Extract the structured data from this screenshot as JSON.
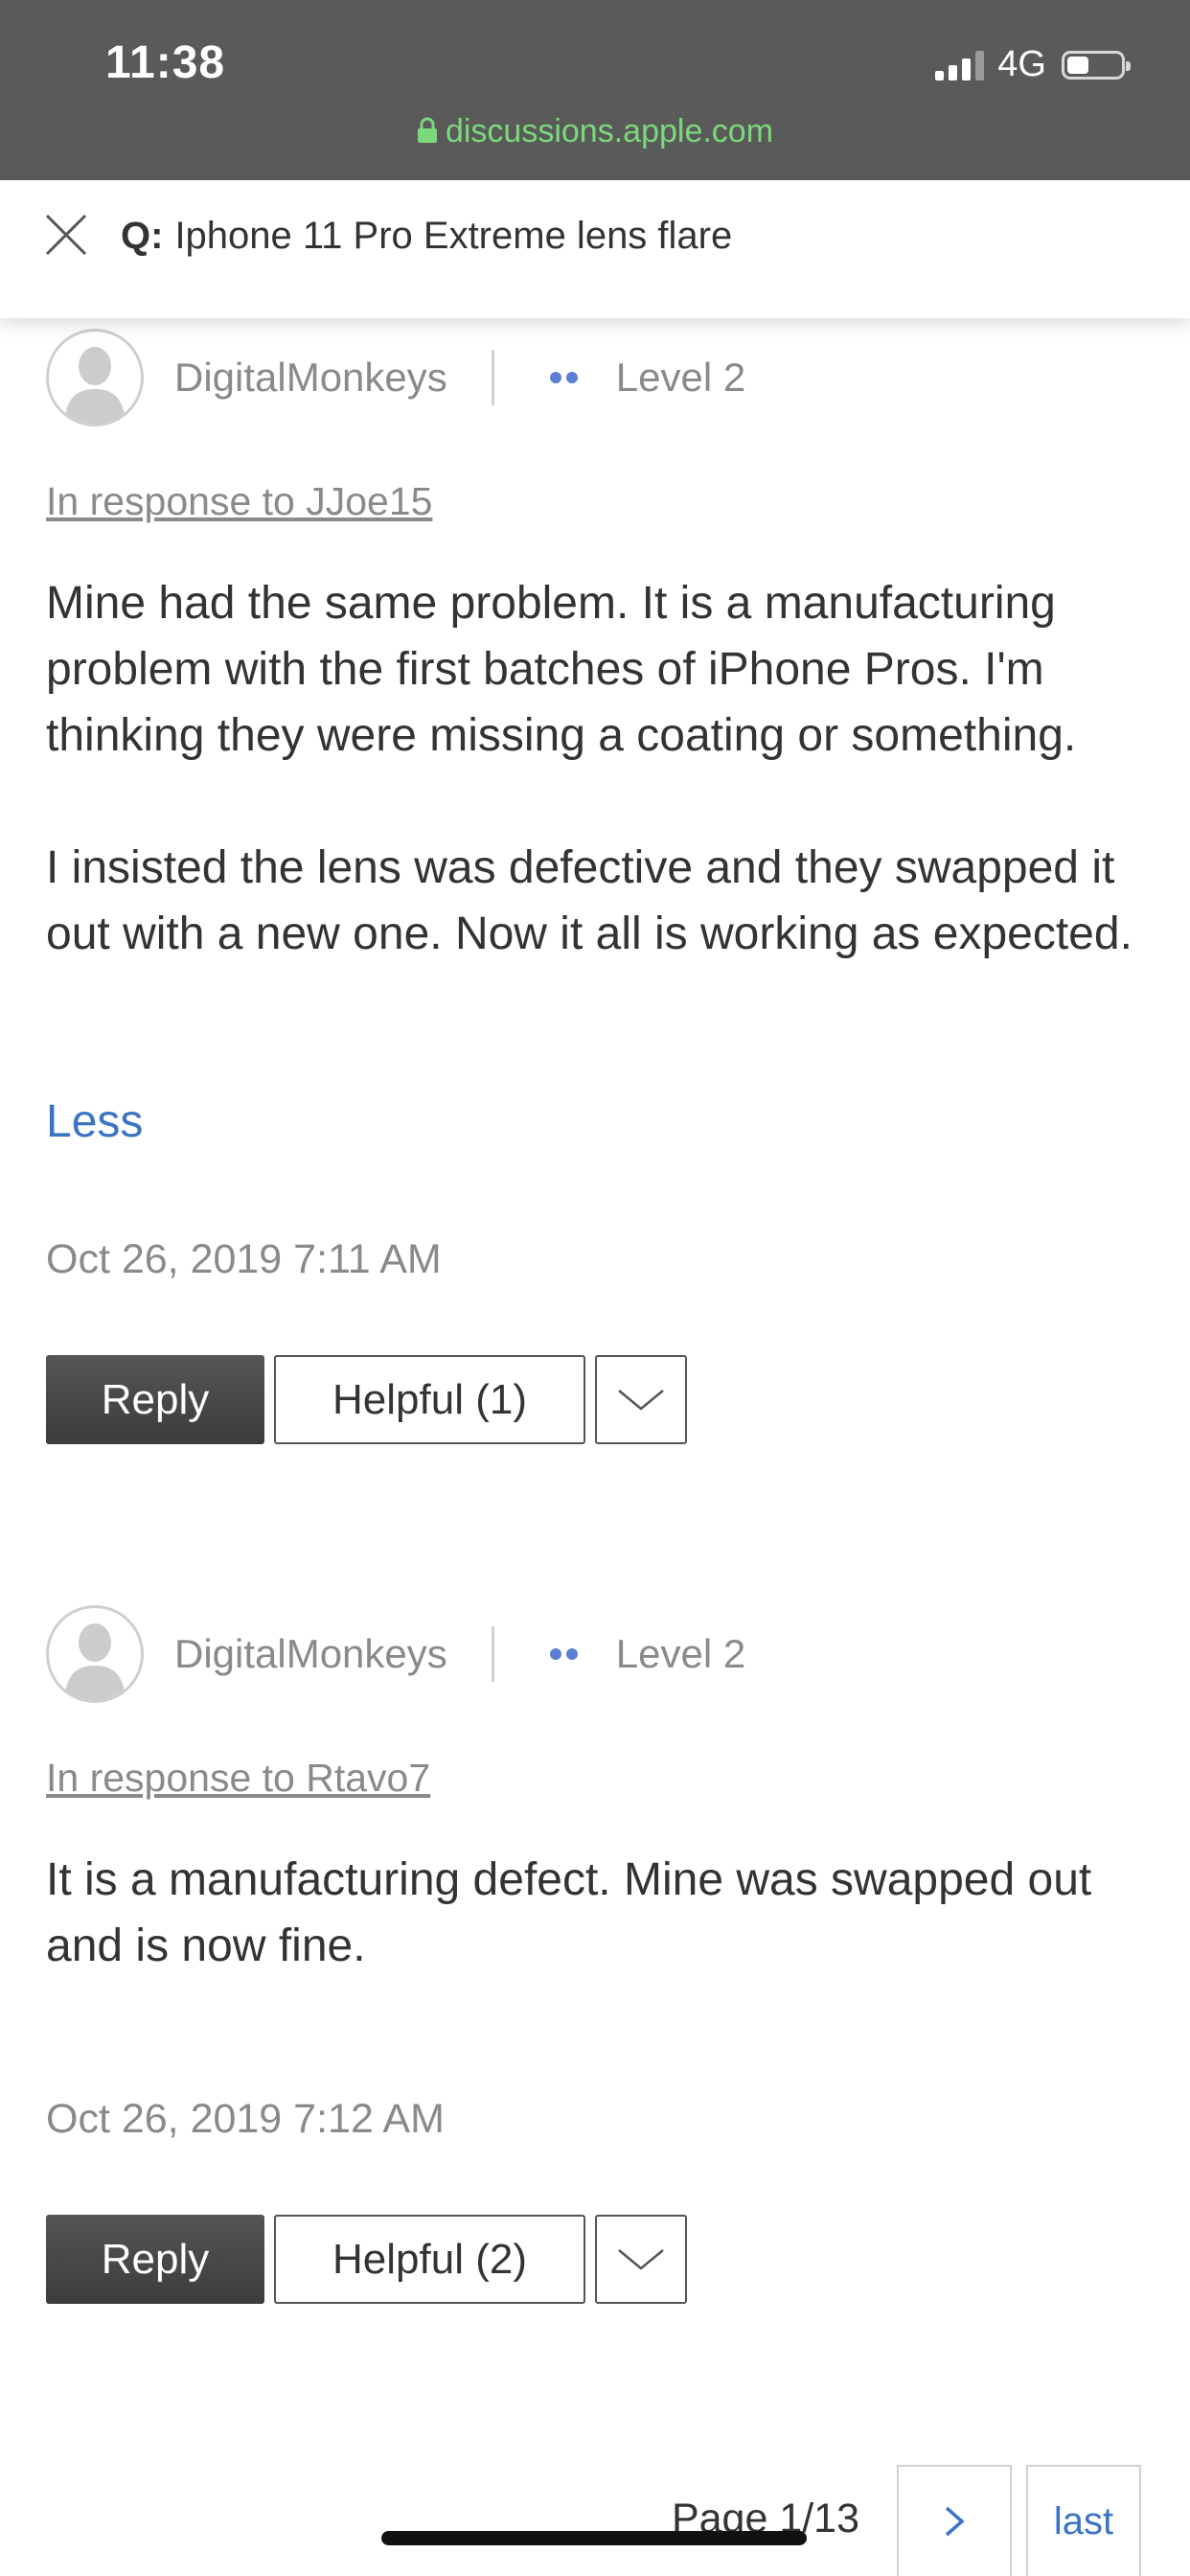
{
  "status_bar": {
    "time": "11:38",
    "network": "4G",
    "url": "discussions.apple.com",
    "icons": [
      "signal-icon",
      "battery-icon",
      "lock-icon"
    ]
  },
  "header": {
    "q_label": "Q:",
    "title": "Iphone 11 Pro Extreme lens flare",
    "icon": "close-icon"
  },
  "posts": [
    {
      "author": "DigitalMonkeys",
      "level": "Level 2",
      "in_response_to": "In response to JJoe15",
      "paragraphs": [
        "Mine had the same problem. It is a manufacturing problem with the first batches of iPhone Pros. I'm thinking they were missing a coating or something.",
        "I insisted the lens was defective and they swapped it out with a new one. Now it all is working as expected."
      ],
      "less_label": "Less",
      "timestamp": "Oct 26, 2019 7:11 AM",
      "reply_label": "Reply",
      "helpful_label": "Helpful (1)"
    },
    {
      "author": "DigitalMonkeys",
      "level": "Level 2",
      "in_response_to": "In response to Rtavo7",
      "paragraphs": [
        "It is a manufacturing defect. Mine was swapped out and is now fine."
      ],
      "timestamp": "Oct 26, 2019 7:12 AM",
      "reply_label": "Reply",
      "helpful_label": "Helpful (2)"
    }
  ],
  "pagination": {
    "label": "Page 1/13",
    "next_icon": "chevron-right-icon",
    "last_label": "last"
  },
  "colors": {
    "status_bar_bg": "#5a5a5a",
    "url_green": "#7bd97b",
    "link_blue": "#3b74c4",
    "level_dots": "#5b7fd4",
    "reply_button": "#4a4a4a"
  }
}
